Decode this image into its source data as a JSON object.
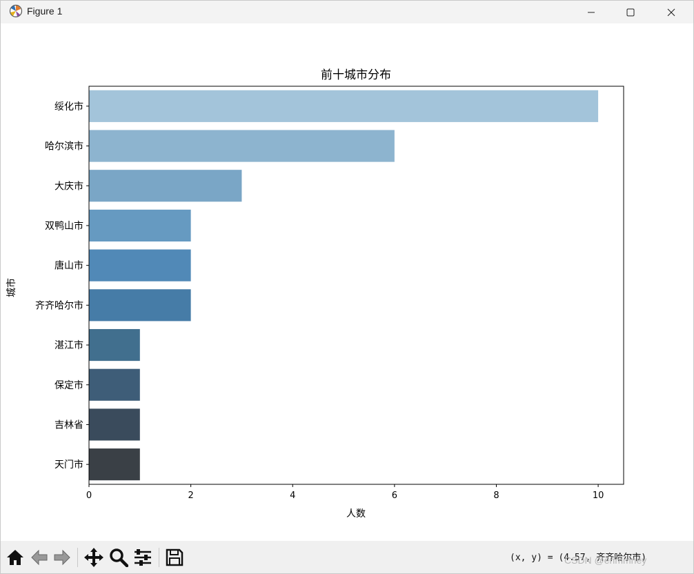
{
  "window": {
    "title": "Figure 1",
    "icons": {
      "app": "matplotlib-icon",
      "minimize": "minimize-icon",
      "maximize": "maximize-icon",
      "close": "close-icon"
    }
  },
  "chart_data": {
    "type": "bar",
    "orientation": "horizontal",
    "title": "前十城市分布",
    "xlabel": "人数",
    "ylabel": "城市",
    "categories": [
      "绥化市",
      "哈尔滨市",
      "大庆市",
      "双鸭山市",
      "唐山市",
      "齐齐哈尔市",
      "湛江市",
      "保定市",
      "吉林省",
      "天门市"
    ],
    "values": [
      10,
      6,
      3,
      2,
      2,
      2,
      1,
      1,
      1,
      1
    ],
    "colors": [
      "#a3c4da",
      "#8db4cf",
      "#7aa6c6",
      "#669ac1",
      "#5189b7",
      "#467ca7",
      "#416f8e",
      "#3e5d78",
      "#3a4b5c",
      "#3a4046"
    ],
    "xlim": [
      0,
      10.5
    ],
    "xticks": [
      0,
      2,
      4,
      6,
      8,
      10
    ],
    "grid": false,
    "legend": "none"
  },
  "toolbar": {
    "icons": [
      "home-icon",
      "back-icon",
      "forward-icon",
      "pan-icon",
      "zoom-icon",
      "configure-subplots-icon",
      "save-icon"
    ],
    "coords_text": "(x, y) = (4.57, 齐齐哈尔市)"
  },
  "watermark": "CSDN @enmmney"
}
